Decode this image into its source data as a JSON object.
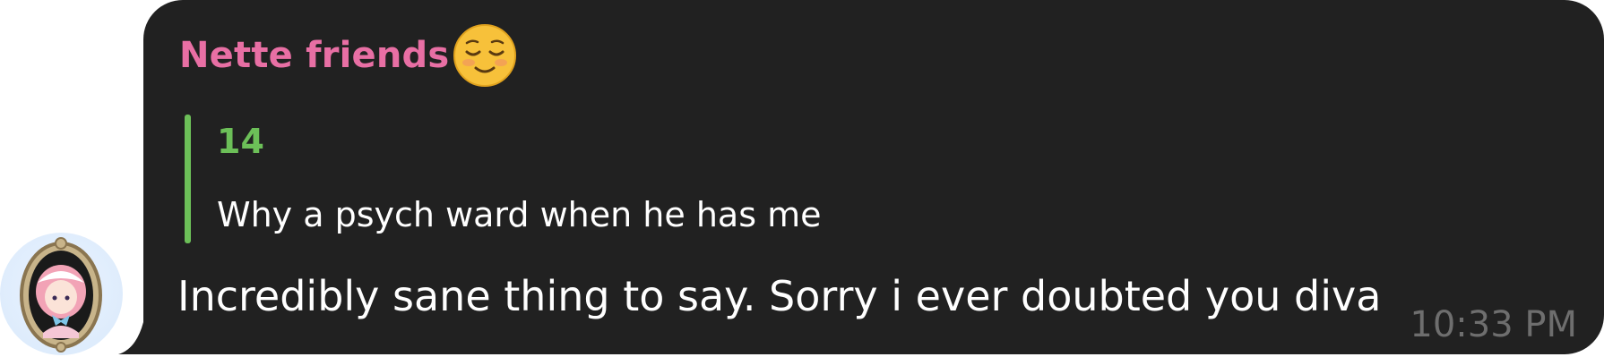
{
  "message": {
    "sender_name": "Nette friends",
    "sender_emoji": "relieved-face-emoji",
    "reply": {
      "author": "14",
      "text": "Why a psych ward when he has me"
    },
    "text": "Incredibly sane thing to say. Sorry i ever doubted you diva",
    "time": "10:33 PM"
  },
  "colors": {
    "bubble_bg": "#212121",
    "sender_name": "#e86fa4",
    "reply_accent": "#6cbf58",
    "timestamp": "#6e6e6e"
  }
}
